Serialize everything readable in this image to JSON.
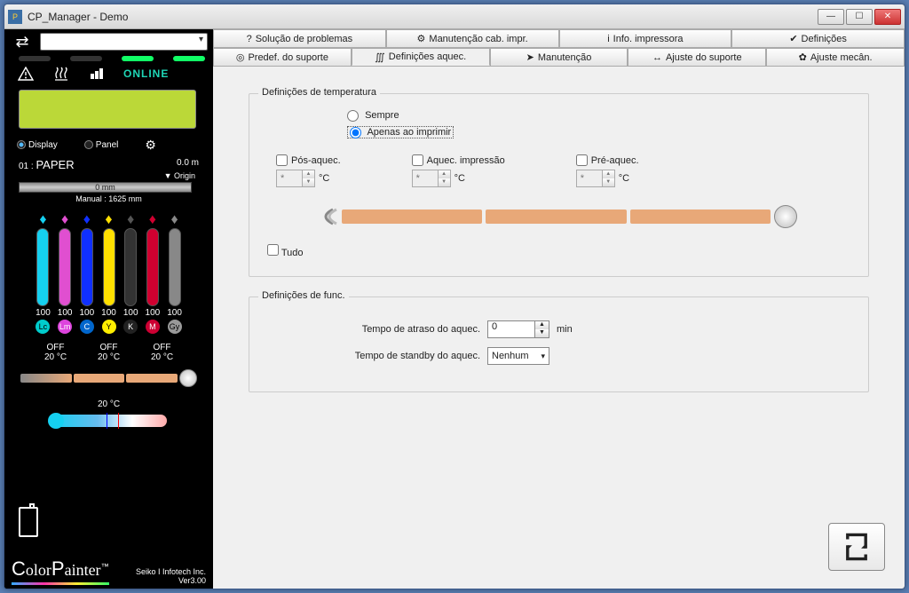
{
  "window": {
    "title": "CP_Manager - Demo"
  },
  "sidebar": {
    "status_online": "ONLINE",
    "display_label": "Display",
    "panel_label": "Panel",
    "media": {
      "slot": "01 :",
      "name": "PAPER",
      "pos": "0.0  m",
      "origin": "▼ Origin",
      "bar": "0   mm",
      "manual": "Manual : 1625   mm"
    },
    "inks": [
      {
        "code": "Lc",
        "level": "100",
        "drop": "#15d0f0",
        "fill": "#15d0f0",
        "label_bg": "#0cc",
        "label_fg": "#000"
      },
      {
        "code": "Lm",
        "level": "100",
        "drop": "#e04fd0",
        "fill": "#e04fd0",
        "label_bg": "#d4d",
        "label_fg": "#fff"
      },
      {
        "code": "C",
        "level": "100",
        "drop": "#1030ff",
        "fill": "#1030ff",
        "label_bg": "#06c",
        "label_fg": "#fff"
      },
      {
        "code": "Y",
        "level": "100",
        "drop": "#ffe000",
        "fill": "#ffe000",
        "label_bg": "#fe0",
        "label_fg": "#000"
      },
      {
        "code": "K",
        "level": "100",
        "drop": "#555",
        "fill": "#333",
        "label_bg": "#222",
        "label_fg": "#fff"
      },
      {
        "code": "M",
        "level": "100",
        "drop": "#d00030",
        "fill": "#d00030",
        "label_bg": "#c03",
        "label_fg": "#fff"
      },
      {
        "code": "Gy",
        "level": "100",
        "drop": "#888",
        "fill": "#888",
        "label_bg": "#999",
        "label_fg": "#000"
      }
    ],
    "heater_status": [
      {
        "state": "OFF",
        "temp": "20 °C"
      },
      {
        "state": "OFF",
        "temp": "20 °C"
      },
      {
        "state": "OFF",
        "temp": "20 °C"
      }
    ],
    "env_temp": "20 °C",
    "logo": "ColorPainter",
    "company": "Seiko I Infotech Inc.",
    "version": "Ver3.00"
  },
  "tabs_top": [
    {
      "icon": "?",
      "label": "Solução de problemas"
    },
    {
      "icon": "⚙",
      "label": "Manutenção cab. impr."
    },
    {
      "icon": "i",
      "label": "Info. impressora"
    },
    {
      "icon": "✔",
      "label": "Definições"
    }
  ],
  "tabs_bottom": [
    {
      "icon": "◎",
      "label": "Predef. do suporte"
    },
    {
      "icon": "∭",
      "label": "Definições aquec."
    },
    {
      "icon": "➤",
      "label": "Manutenção"
    },
    {
      "icon": "↔",
      "label": "Ajuste do suporte"
    },
    {
      "icon": "✿",
      "label": "Ajuste mecân."
    }
  ],
  "temp_group": {
    "title": "Definições de temperatura",
    "opt_always": "Sempre",
    "opt_printing": "Apenas ao imprimir",
    "heaters": [
      {
        "name": "Pós-aquec.",
        "val": "*"
      },
      {
        "name": "Aquec. impressão",
        "val": "*"
      },
      {
        "name": "Pré-aquec.",
        "val": "*"
      }
    ],
    "unit": "°C",
    "tudo": "Tudo"
  },
  "func_group": {
    "title": "Definições de func.",
    "delay_label": "Tempo de atraso do aquec.",
    "delay_val": "0",
    "delay_unit": "min",
    "standby_label": "Tempo de standby do aquec.",
    "standby_val": "Nenhum"
  }
}
